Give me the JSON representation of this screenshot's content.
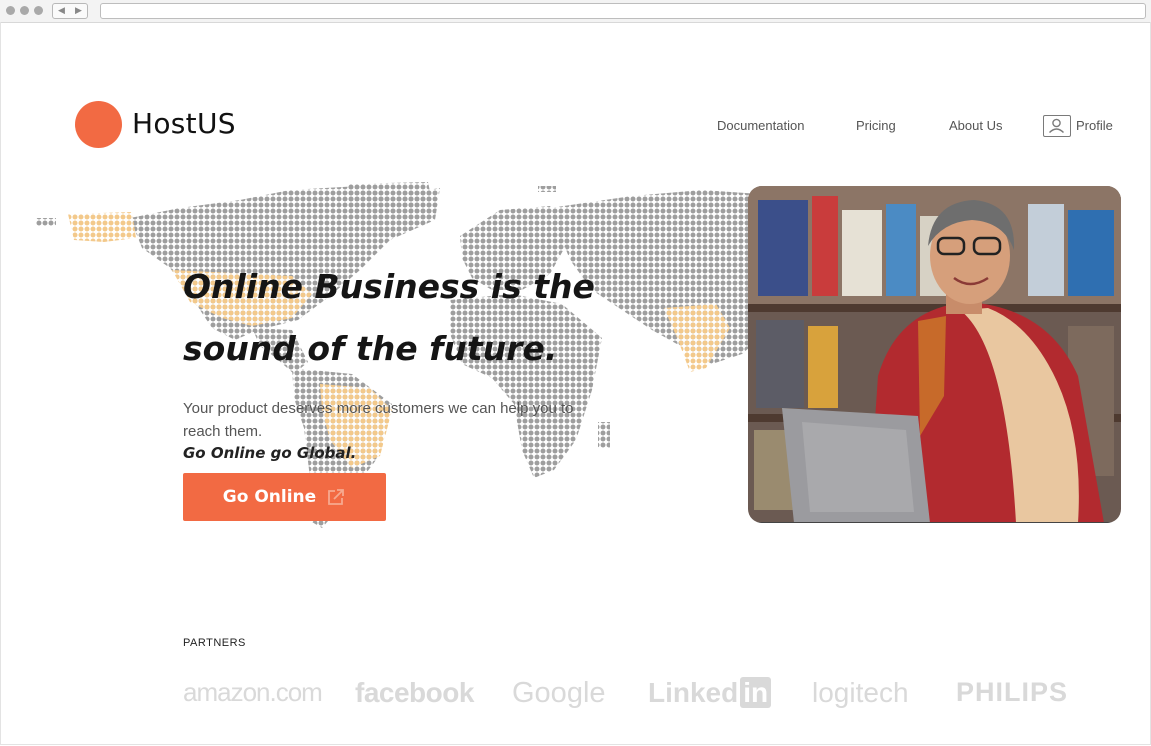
{
  "brand": {
    "name": "HostUS",
    "logo_color": "#f26a43"
  },
  "nav": {
    "documentation": "Documentation",
    "pricing": "Pricing",
    "about": "About Us",
    "profile": "Profile"
  },
  "hero": {
    "headline_1": "Online Business is the",
    "headline_2": "sound of the future.",
    "subtitle": "Your product deserves more customers we can help you to reach them.",
    "tagline": "Go Online go Global.",
    "cta_label": "Go Online"
  },
  "partners": {
    "label": "PARTNERS",
    "logos": [
      "amazon.com",
      "facebook",
      "Google",
      "Linked",
      "in",
      "logitech",
      "PHILIPS"
    ]
  },
  "colors": {
    "accent": "#f26a43",
    "map_dot": "#9e9e9e",
    "map_highlight": "#f3c98b"
  }
}
